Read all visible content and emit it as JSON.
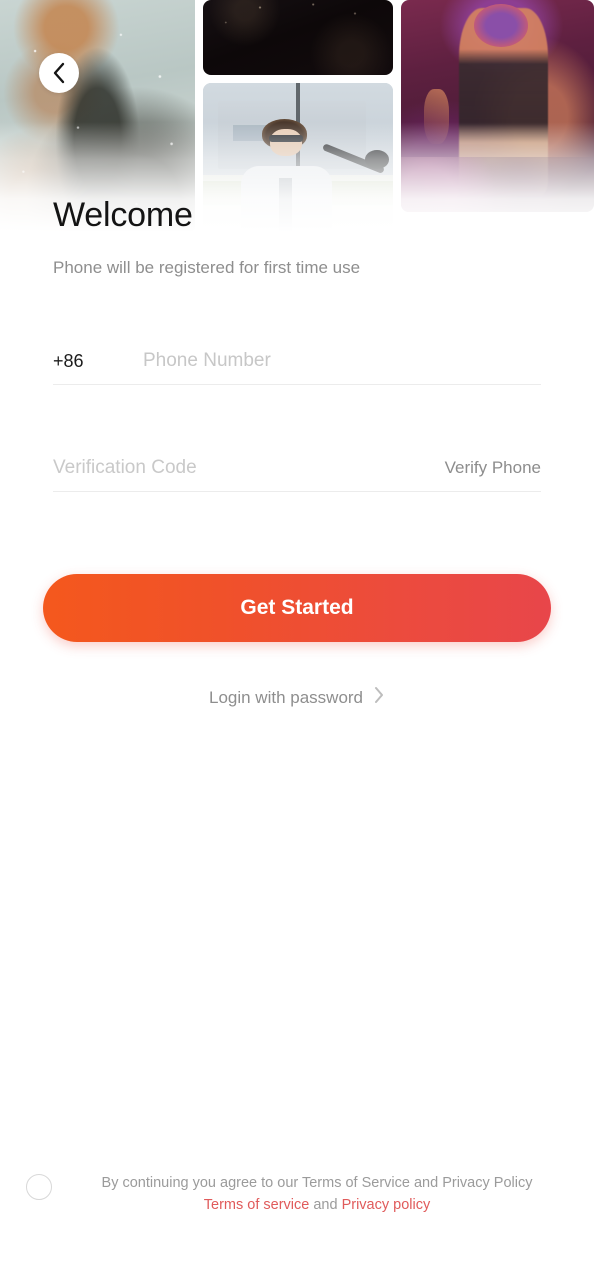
{
  "header": {
    "back_icon": "chevron-left-icon",
    "title": "Welcome",
    "subtitle": "Phone will be registered for first time use",
    "photos": [
      {
        "name": "concert-misty-performer"
      },
      {
        "name": "concert-night-dark"
      },
      {
        "name": "daylight-singer-sunglasses"
      },
      {
        "name": "stage-purple-performer-crowd"
      }
    ]
  },
  "form": {
    "country_code": "+86",
    "phone_placeholder": "Phone Number",
    "phone_value": "",
    "code_placeholder": "Verification Code",
    "code_value": "",
    "verify_label": "Verify Phone"
  },
  "actions": {
    "submit_label": "Get Started",
    "password_login_label": "Login with password",
    "password_login_icon": "chevron-right-icon"
  },
  "terms": {
    "checkbox_icon": "circle-checkbox-unchecked-icon",
    "checked": false,
    "line1": "By continuing you agree to our Terms of Service and Privacy Policy",
    "terms_link": "Terms of service",
    "conjunction": " and ",
    "privacy_link": "Privacy policy"
  },
  "colors": {
    "gradient_start": "#f4581d",
    "gradient_end": "#e8464a",
    "link_red": "#e05b5b",
    "muted_text": "#8e8e8e",
    "placeholder": "#c7c7c7",
    "background": "#ffffff"
  }
}
